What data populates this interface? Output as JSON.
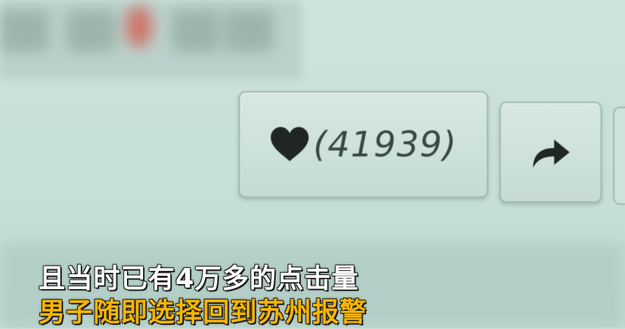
{
  "like_button": {
    "count_text": "(41939)",
    "icon": "heart-icon"
  },
  "share_button": {
    "icon": "share-arrow-icon"
  },
  "captions": {
    "line1": "且当时已有4万多的点击量",
    "line2": "男子随即选择回到苏州报警"
  },
  "colors": {
    "background": "#c8e0da",
    "caption_line1": "#ffffff",
    "caption_line2": "#f5b400"
  }
}
